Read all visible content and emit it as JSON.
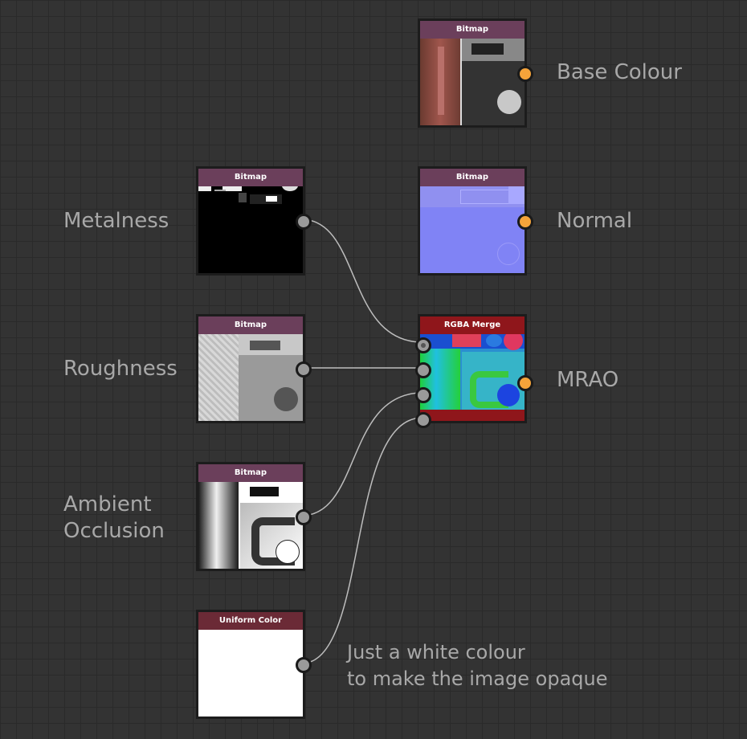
{
  "nodes": {
    "base_colour": {
      "header": "Bitmap",
      "label": "Base Colour"
    },
    "metalness": {
      "header": "Bitmap",
      "label": "Metalness"
    },
    "normal": {
      "header": "Bitmap",
      "label": "Normal"
    },
    "roughness": {
      "header": "Bitmap",
      "label": "Roughness"
    },
    "rgba_merge": {
      "header": "RGBA Merge",
      "label": "MRAO"
    },
    "ambient_occlusion": {
      "header": "Bitmap",
      "label_line1": "Ambient",
      "label_line2": "Occlusion"
    },
    "uniform_color": {
      "header": "Uniform Color"
    }
  },
  "note": {
    "line1": "Just a white colour",
    "line2": "to make the image opaque"
  },
  "colors": {
    "background": "#333333",
    "grid": "#2a2a2a",
    "bitmap_header": "#6b3f5b",
    "merge_header": "#8f161b",
    "output_port": "#f5a33a",
    "wire": "#bdbdbd",
    "label_text": "#a8a8a8"
  }
}
